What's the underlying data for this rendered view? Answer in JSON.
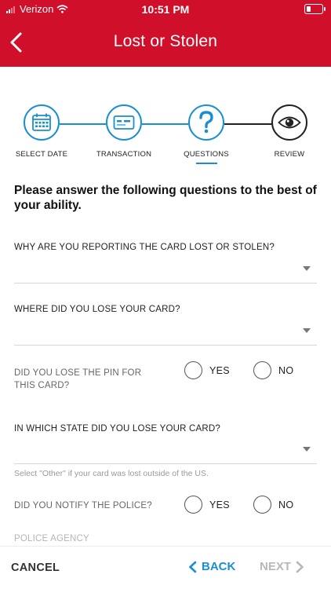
{
  "status_bar": {
    "carrier": "Verizon",
    "time": "10:51 PM",
    "battery_level": 0.3
  },
  "nav": {
    "title": "Lost or Stolen",
    "back_icon": "chevron-left-icon"
  },
  "steps": [
    {
      "label": "SELECT DATE",
      "icon": "calendar-icon",
      "state": "complete"
    },
    {
      "label": "TRANSACTION",
      "icon": "card-icon",
      "state": "complete"
    },
    {
      "label": "QUESTIONS",
      "icon": "question-icon",
      "state": "active"
    },
    {
      "label": "REVIEW",
      "icon": "eye-icon",
      "state": "pending"
    }
  ],
  "intro": "Please answer the following questions to the best of your ability.",
  "questions": {
    "reason": {
      "label": "WHY ARE YOU REPORTING THE CARD LOST OR STOLEN?",
      "value": ""
    },
    "where": {
      "label": "WHERE DID YOU LOSE YOUR CARD?",
      "value": ""
    },
    "pin": {
      "label": "DID YOU LOSE THE PIN FOR THIS CARD?",
      "yes": "YES",
      "no": "NO"
    },
    "state": {
      "label": "IN WHICH STATE DID YOU LOSE YOUR CARD?",
      "value": "",
      "hint": "Select \"Other\" if your card was lost outside of the US."
    },
    "police": {
      "label": "DID YOU NOTIFY THE POLICE?",
      "yes": "YES",
      "no": "NO"
    },
    "agency": {
      "label": "POLICE AGENCY"
    }
  },
  "footer": {
    "cancel": "CANCEL",
    "back": "BACK",
    "next": "NEXT"
  },
  "colors": {
    "brand_red": "#d0102b",
    "accent_blue": "#1a8fd0",
    "disabled": "#b8b8b8"
  }
}
